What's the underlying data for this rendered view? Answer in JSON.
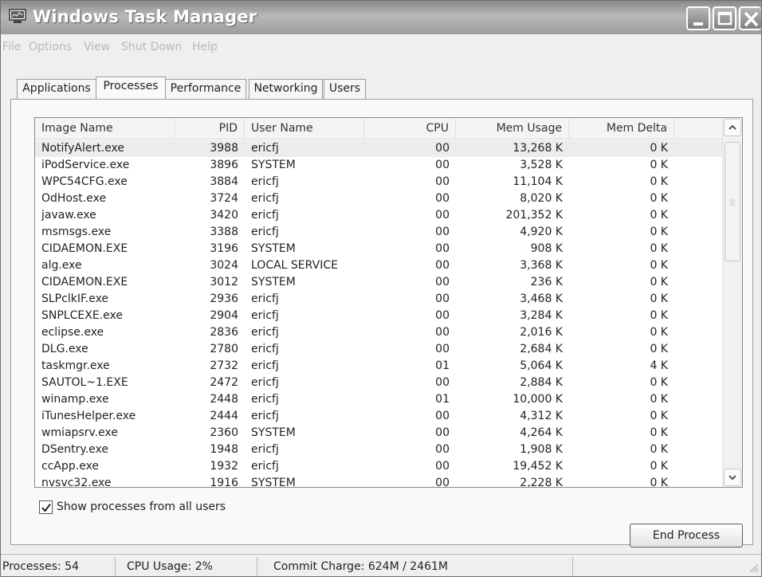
{
  "window": {
    "title": "Windows Task Manager"
  },
  "menu": [
    "File",
    "Options",
    "View",
    "Shut Down",
    "Help"
  ],
  "tabs": [
    "Applications",
    "Processes",
    "Performance",
    "Networking",
    "Users"
  ],
  "active_tab": "Processes",
  "columns": [
    "Image Name",
    "PID",
    "User Name",
    "CPU",
    "Mem Usage",
    "Mem Delta"
  ],
  "processes": [
    {
      "name": "NotifyAlert.exe",
      "pid": "3988",
      "user": "ericfj",
      "cpu": "00",
      "mem": "13,268 K",
      "delta": "0 K"
    },
    {
      "name": "iPodService.exe",
      "pid": "3896",
      "user": "SYSTEM",
      "cpu": "00",
      "mem": "3,528 K",
      "delta": "0 K"
    },
    {
      "name": "WPC54CFG.exe",
      "pid": "3884",
      "user": "ericfj",
      "cpu": "00",
      "mem": "11,104 K",
      "delta": "0 K"
    },
    {
      "name": "OdHost.exe",
      "pid": "3724",
      "user": "ericfj",
      "cpu": "00",
      "mem": "8,020 K",
      "delta": "0 K"
    },
    {
      "name": "javaw.exe",
      "pid": "3420",
      "user": "ericfj",
      "cpu": "00",
      "mem": "201,352 K",
      "delta": "0 K"
    },
    {
      "name": "msmsgs.exe",
      "pid": "3388",
      "user": "ericfj",
      "cpu": "00",
      "mem": "4,920 K",
      "delta": "0 K"
    },
    {
      "name": "CIDAEMON.EXE",
      "pid": "3196",
      "user": "SYSTEM",
      "cpu": "00",
      "mem": "908 K",
      "delta": "0 K"
    },
    {
      "name": "alg.exe",
      "pid": "3024",
      "user": "LOCAL SERVICE",
      "cpu": "00",
      "mem": "3,368 K",
      "delta": "0 K"
    },
    {
      "name": "CIDAEMON.EXE",
      "pid": "3012",
      "user": "SYSTEM",
      "cpu": "00",
      "mem": "236 K",
      "delta": "0 K"
    },
    {
      "name": "SLPclkIF.exe",
      "pid": "2936",
      "user": "ericfj",
      "cpu": "00",
      "mem": "3,468 K",
      "delta": "0 K"
    },
    {
      "name": "SNPLCEXE.exe",
      "pid": "2904",
      "user": "ericfj",
      "cpu": "00",
      "mem": "3,284 K",
      "delta": "0 K"
    },
    {
      "name": "eclipse.exe",
      "pid": "2836",
      "user": "ericfj",
      "cpu": "00",
      "mem": "2,016 K",
      "delta": "0 K"
    },
    {
      "name": "DLG.exe",
      "pid": "2780",
      "user": "ericfj",
      "cpu": "00",
      "mem": "2,684 K",
      "delta": "0 K"
    },
    {
      "name": "taskmgr.exe",
      "pid": "2732",
      "user": "ericfj",
      "cpu": "01",
      "mem": "5,064 K",
      "delta": "4 K"
    },
    {
      "name": "SAUTOL~1.EXE",
      "pid": "2472",
      "user": "ericfj",
      "cpu": "00",
      "mem": "2,884 K",
      "delta": "0 K"
    },
    {
      "name": "winamp.exe",
      "pid": "2448",
      "user": "ericfj",
      "cpu": "01",
      "mem": "10,000 K",
      "delta": "0 K"
    },
    {
      "name": "iTunesHelper.exe",
      "pid": "2444",
      "user": "ericfj",
      "cpu": "00",
      "mem": "4,312 K",
      "delta": "0 K"
    },
    {
      "name": "wmiapsrv.exe",
      "pid": "2360",
      "user": "SYSTEM",
      "cpu": "00",
      "mem": "4,264 K",
      "delta": "0 K"
    },
    {
      "name": "DSentry.exe",
      "pid": "1948",
      "user": "ericfj",
      "cpu": "00",
      "mem": "1,908 K",
      "delta": "0 K"
    },
    {
      "name": "ccApp.exe",
      "pid": "1932",
      "user": "ericfj",
      "cpu": "00",
      "mem": "19,452 K",
      "delta": "0 K"
    },
    {
      "name": "nvsvc32.exe",
      "pid": "1916",
      "user": "SYSTEM",
      "cpu": "00",
      "mem": "2,228 K",
      "delta": "0 K"
    }
  ],
  "show_all_users": {
    "label": "Show processes from all users",
    "checked": true
  },
  "end_process_label": "End Process",
  "status": {
    "processes": "Processes: 54",
    "cpu": "CPU Usage: 2%",
    "commit": "Commit Charge: 624M / 2461M"
  },
  "colors": {
    "title_bar": "#9c9c9c",
    "window_bg": "#efefef",
    "selected_row": "#ececec"
  }
}
